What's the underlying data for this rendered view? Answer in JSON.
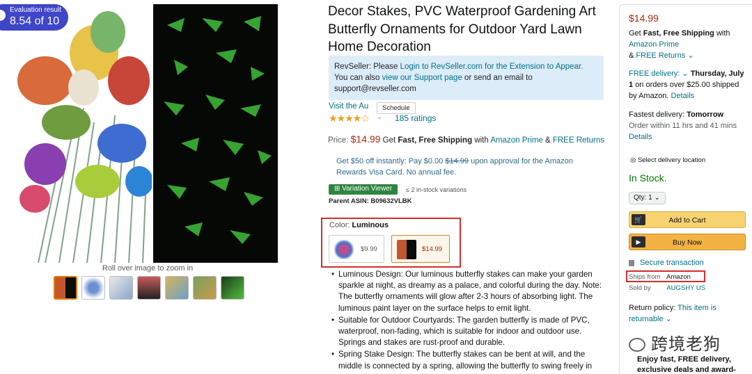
{
  "badge": {
    "label": "Evaluation result",
    "value": "8.54 of 10"
  },
  "gallery": {
    "zoom_hint": "Roll over image to zoom in",
    "thumb_count": 7
  },
  "product": {
    "title": "Decor Stakes, PVC Waterproof Gardening Art Butterfly Ornaments for Outdoor Yard Lawn Home Decoration",
    "visit_link": "Visit the Au",
    "schedule_tooltip": "Schedule",
    "rating_stars": "★★★★☆",
    "rating_count": "185 ratings",
    "price_label": "Price:",
    "price": "$14.99",
    "price_shipping_prefix": "Get",
    "price_shipping_bold": "Fast, Free Shipping",
    "price_shipping_with": "with",
    "price_prime": "Amazon Prime",
    "price_amp": "&",
    "price_returns": "FREE Returns",
    "offer_pre": "Get $50 off instantly: Pay $0.00",
    "offer_struck": "$14.99",
    "offer_post": "upon approval for the Amazon Rewards Visa Card. No annual fee.",
    "variation_button": "Variation Viewer",
    "variation_note": "≤ 2 in-stock variations",
    "parent_asin": "Parent ASIN: B09632VLBK",
    "color_label": "Color:",
    "color_value": "Luminous",
    "swatches": [
      {
        "price": "$9.99"
      },
      {
        "price": "$14.99"
      }
    ],
    "bullets": [
      "Luminous Design: Our luminous butterfly stakes can make your garden sparkle at night, as dreamy as a palace, and colorful during the day. Note: The butterfly ornaments will glow after 2-3 hours of absorbing light. The luminous paint layer on the surface helps to emit light.",
      "Suitable for Outdoor Courtyards: The garden butterfly is made of PVC, waterproof, non-fading, which is suitable for indoor and outdoor use. Springs and stakes are rust-proof and durable.",
      "Spring Stake Design: The butterfly stakes can be bent at will, and the middle is connected by a spring, allowing the butterfly to swing freely in"
    ]
  },
  "revseller": {
    "line1_pre": "RevSeller: Please",
    "line1_link": "Login to RevSeller.com for the Extension to Appear.",
    "line2_pre": "You can also",
    "line2_link": "view our Support page",
    "line2_post": "or send an email to",
    "line3": "support@revseller.com"
  },
  "buybox": {
    "price": "$14.99",
    "ship_get": "Get",
    "ship_bold": "Fast, Free Shipping",
    "ship_with": "with",
    "ship_prime": "Amazon Prime",
    "ship_amp": "&",
    "ship_returns": "FREE Returns",
    "free_delivery": "FREE delivery:",
    "free_date": "Thursday, July 1",
    "free_rest": "on orders over $25.00 shipped by Amazon.",
    "free_details": "Details",
    "fast_label": "Fastest delivery:",
    "fast_day": "Tomorrow",
    "fast_order": "Order within 11 hrs and 41 mins",
    "fast_details": "Details",
    "location": "Select delivery location",
    "stock": "In Stock.",
    "qty": "Qty: 1",
    "add_to_cart": "Add to Cart",
    "buy_now": "Buy Now",
    "secure": "Secure transaction",
    "ships_from_label": "Ships from",
    "ships_from_value": "Amazon",
    "sold_by_label": "Sold by",
    "sold_by_value": "AUGSHY US",
    "return_label": "Return policy:",
    "return_link": "This item is returnable",
    "watermark": "跨境老狗",
    "promo": "Enjoy fast, FREE delivery, exclusive deals and award-"
  },
  "colors": {
    "link": "#007185",
    "price": "#b12704",
    "stock": "#007600",
    "highlight_box": "#d62c2c"
  }
}
